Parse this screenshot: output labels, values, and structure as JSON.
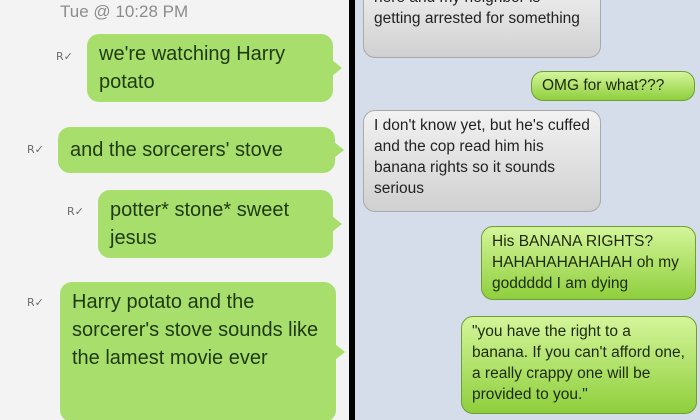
{
  "left": {
    "timestamp": "Tue @ 10:28 PM",
    "receipt_mark": "R",
    "messages": [
      {
        "text": "we're watching Harry potato"
      },
      {
        "text": "and the sorcerers' stove"
      },
      {
        "text": "potter* stone* sweet jesus"
      },
      {
        "text": "Harry potato and the sorcerer's stove sounds like the lamest movie ever"
      }
    ]
  },
  "right": {
    "messages": [
      {
        "text": "here and my neighbor is getting arrested for something",
        "from": "them"
      },
      {
        "text": "OMG for what???",
        "from": "me"
      },
      {
        "text": "I don't know yet, but he's cuffed and the cop read him his banana rights so it sounds serious",
        "from": "them"
      },
      {
        "text": "His BANANA RIGHTS? HAHAHAHAHAHAH oh my goddddd I am dying",
        "from": "me"
      },
      {
        "text": "\"you have the right to a banana. If you can't afford one, a really crappy one will be provided to you.\"",
        "from": "me"
      }
    ]
  },
  "colors": {
    "left_bg": "#f3f3f3",
    "left_bubble": "#a7de6c",
    "right_bg": "#d4dde9",
    "right_gray_bubble": "#e0e0e0",
    "right_green_bubble": "#b5e46a"
  }
}
